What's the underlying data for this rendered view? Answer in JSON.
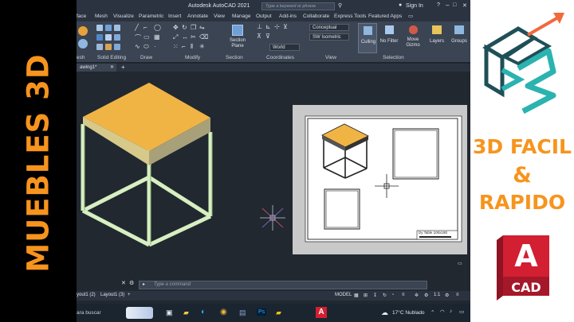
{
  "video_title": "MUEBLES 3D",
  "promo": {
    "line1": "3D FACIL",
    "line2": "&",
    "line3": "RAPIDO"
  },
  "cad_logo": {
    "letter": "A",
    "label": "CAD"
  },
  "rs_logo_icon": "rs-logo-icon",
  "colors": {
    "orange": "#f7941d",
    "ribbon_bg": "#3b4453",
    "viewport_bg": "#212830",
    "autocad_red": "#d21f32"
  },
  "autocad": {
    "title": "Autodesk AutoCAD 2021",
    "search_placeholder": "Type a keyword or phrase",
    "sign_in": "Sign In",
    "menu": [
      "face",
      "Mesh",
      "Visualize",
      "Parametric",
      "Insert",
      "Annotate",
      "View",
      "Manage",
      "Output",
      "Add-ins",
      "Collaborate",
      "Express Tools",
      "Featured Apps"
    ],
    "ribbon": {
      "panels": [
        "esh",
        "Solid Editing",
        "Draw",
        "Modify",
        "Section",
        "Coordinates",
        "View",
        "Selection"
      ],
      "section_plane": "Section\nPlane",
      "visual_style": "Conceptual",
      "view_preset": "SW Isometric",
      "ucs": "World",
      "buttons": {
        "culling": "Culling",
        "no_filter": "No Filter",
        "move_gizmo": "Move\nGizmo",
        "layers": "Layers",
        "groups": "Groups"
      }
    },
    "doc_tab": "awing1*",
    "command_placeholder": "Type a command",
    "layout_tabs": [
      "yout1 (2)",
      "Layout1 (3)"
    ],
    "status": {
      "model": "MODEL",
      "scale": "1:1"
    },
    "title_block": "lzy Table 100x180"
  },
  "taskbar": {
    "search": "ara buscar",
    "weather": "17°C Nublado"
  }
}
